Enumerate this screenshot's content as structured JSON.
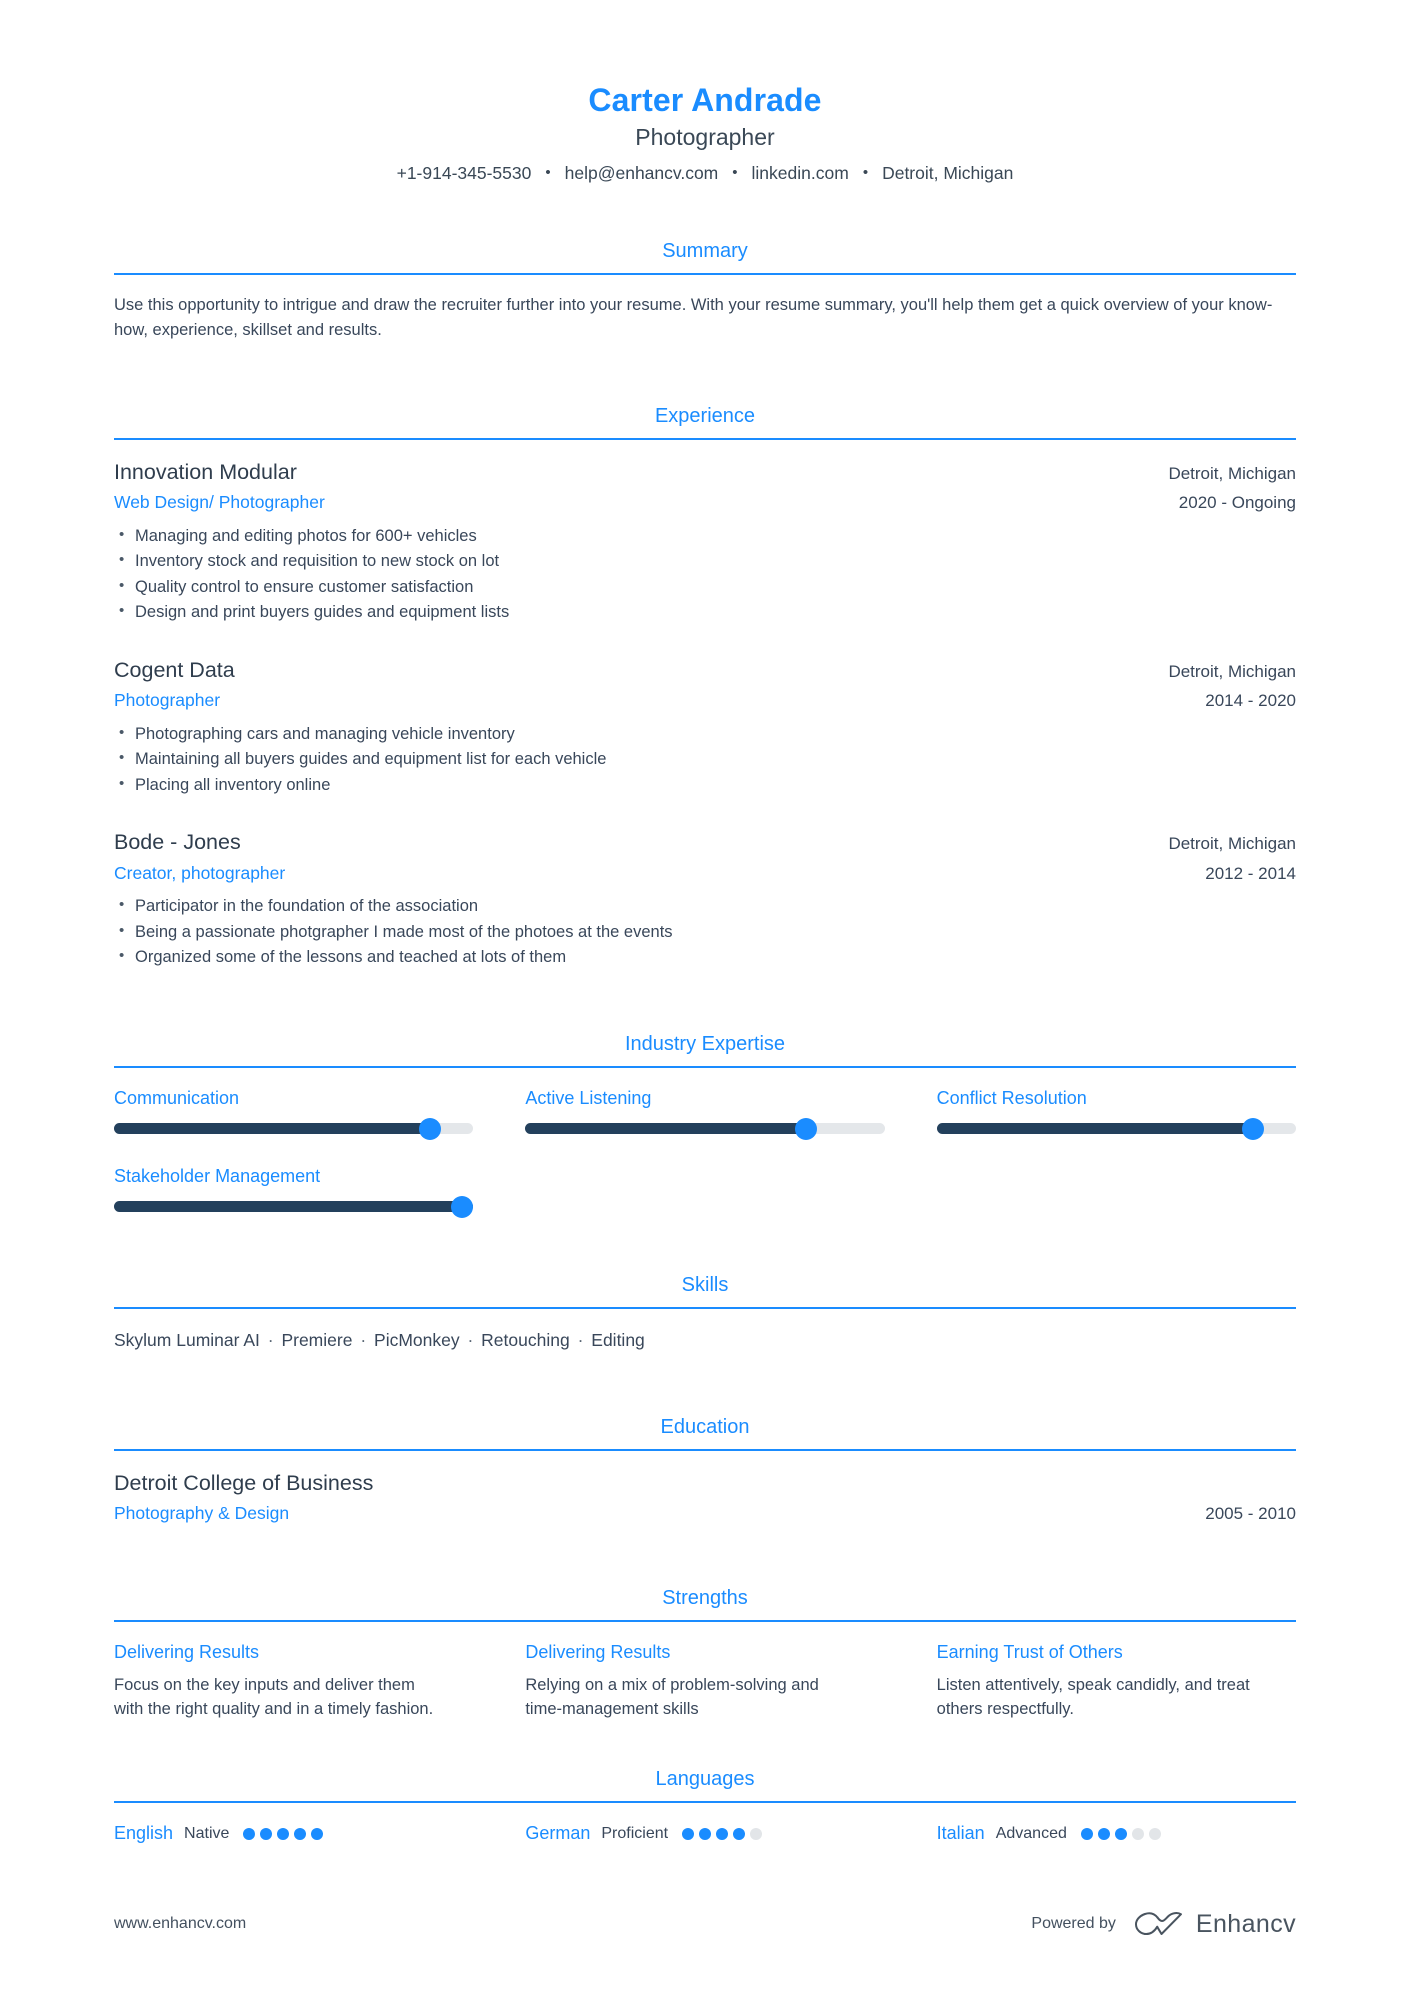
{
  "theme": {
    "accent": "#1a8cff",
    "text": "#39475a",
    "heading": "#2f3d4d",
    "track_filled": "#23405c",
    "track_empty": "#e4e7ea",
    "dot_empty": "#e2e5e8"
  },
  "header": {
    "full_name": "Carter Andrade",
    "job_title": "Photographer",
    "separator": "•",
    "contacts": [
      "+1-914-345-5530",
      "help@enhancv.com",
      "linkedin.com",
      "Detroit, Michigan"
    ]
  },
  "summary": {
    "title": "Summary",
    "text": "Use this opportunity to intrigue and draw the recruiter further into your resume. With your resume summary, you'll help them get a quick overview of your know-how, experience, skillset and results."
  },
  "experience": {
    "title": "Experience",
    "entries": [
      {
        "company": "Innovation Modular",
        "role": "Web Design/ Photographer",
        "location": "Detroit, Michigan",
        "dates": "2020 - Ongoing",
        "bullets": [
          "Managing and editing photos for 600+ vehicles",
          "Inventory stock and requisition to new stock on lot",
          "Quality control to ensure customer satisfaction",
          "Design and print buyers guides and equipment lists"
        ]
      },
      {
        "company": "Cogent Data",
        "role": "Photographer",
        "location": "Detroit, Michigan",
        "dates": "2014 - 2020",
        "bullets": [
          "Photographing cars and managing vehicle inventory",
          "Maintaining all buyers guides and equipment list for each vehicle",
          "Placing all inventory online"
        ]
      },
      {
        "company": "Bode - Jones",
        "role": "Creator, photographer",
        "location": "Detroit, Michigan",
        "dates": "2012 - 2014",
        "bullets": [
          "Participator in the foundation of the association",
          "Being a passionate photgrapher I made most of the photoes at the events",
          "Organized some of the lessons and teached at lots of them"
        ]
      }
    ]
  },
  "industry_expertise": {
    "title": "Industry Expertise",
    "skills": [
      {
        "label": "Communication",
        "percent": 88
      },
      {
        "label": "Active Listening",
        "percent": 78
      },
      {
        "label": "Conflict Resolution",
        "percent": 88
      },
      {
        "label": "Stakeholder Management",
        "percent": 100
      }
    ]
  },
  "skills": {
    "title": "Skills",
    "separator": "·",
    "items": [
      "Skylum Luminar AI",
      "Premiere",
      "PicMonkey",
      "Retouching",
      "Editing"
    ]
  },
  "education": {
    "title": "Education",
    "entries": [
      {
        "school": "Detroit College of Business",
        "degree": "Photography & Design",
        "dates": "2005 - 2010"
      }
    ]
  },
  "strengths": {
    "title": "Strengths",
    "items": [
      {
        "name": "Delivering Results",
        "description": "Focus on the key inputs and deliver them with the right quality and in a timely fashion."
      },
      {
        "name": "Delivering Results",
        "description": "Relying on a mix of problem-solving and time-management skills"
      },
      {
        "name": "Earning Trust of Others",
        "description": "Listen attentively, speak candidly, and treat others respectfully."
      }
    ]
  },
  "languages": {
    "title": "Languages",
    "max_dots": 5,
    "items": [
      {
        "name": "English",
        "level": "Native",
        "dots": 5
      },
      {
        "name": "German",
        "level": "Proficient",
        "dots": 4
      },
      {
        "name": "Italian",
        "level": "Advanced",
        "dots": 3
      }
    ]
  },
  "footer": {
    "url": "www.enhancv.com",
    "powered_by": "Powered by",
    "brand": "Enhancv"
  }
}
